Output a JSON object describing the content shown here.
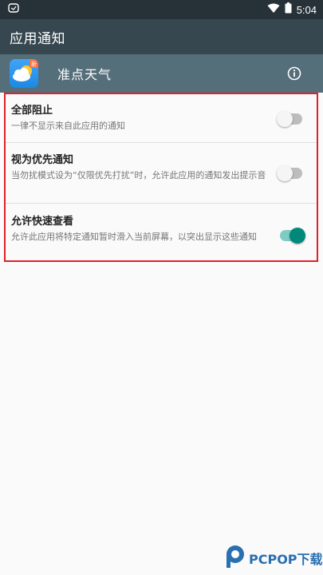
{
  "status_bar": {
    "time": "5:04",
    "icons": [
      "notification-icon",
      "wifi-icon",
      "battery-icon"
    ]
  },
  "app_bar": {
    "title": "应用通知"
  },
  "app_header": {
    "app_name": "准点天气",
    "app_icon_badge": "新",
    "info_icon": "info-icon"
  },
  "settings": [
    {
      "title": "全部阻止",
      "subtitle": "一律不显示来自此应用的通知",
      "enabled": false
    },
    {
      "title": "视为优先通知",
      "subtitle": "当勿扰模式设为“仅限优先打扰”时，允许此应用的通知发出提示音",
      "enabled": false
    },
    {
      "title": "允许快速查看",
      "subtitle": "允许此应用将特定通知暂时滑入当前屏幕，以突出显示这些通知",
      "enabled": true
    }
  ],
  "colors": {
    "status_bar": "#263238",
    "app_bar": "#37474f",
    "app_header": "#546e7a",
    "highlight_border": "#e0202a",
    "toggle_on": "#00897b"
  },
  "watermark": {
    "text": "PCPOP下载"
  }
}
